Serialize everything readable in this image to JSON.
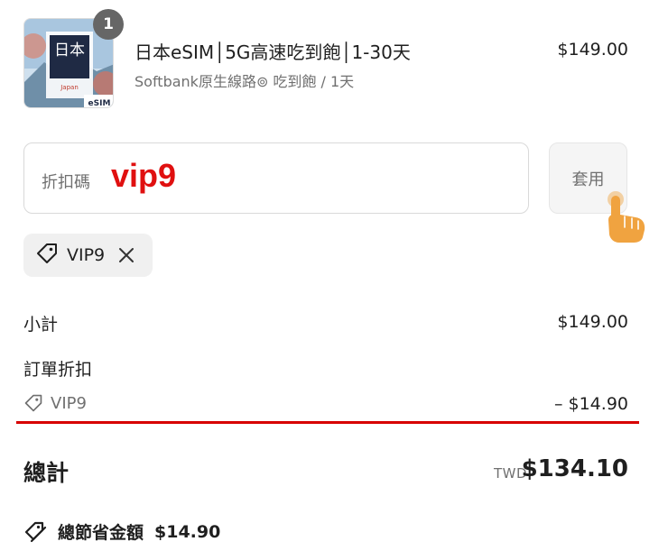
{
  "product": {
    "quantity": "1",
    "title": "日本eSIM│5G高速吃到飽│1-30天",
    "variant": "Softbank原生線路⊚ 吃到飽 / 1天",
    "price": "$149.00",
    "image_text": {
      "main": "日本",
      "place": "Japan",
      "brand": "eSIM"
    }
  },
  "discount": {
    "placeholder": "折扣碼",
    "value": "vip9",
    "apply_label": "套用",
    "applied_code": "VIP9"
  },
  "summary": {
    "subtotal_label": "小計",
    "subtotal_value": "$149.00",
    "order_discount_label": "訂單折扣",
    "discount_code": "VIP9",
    "discount_value": "– $14.90",
    "total_label": "總計",
    "currency": "TWD",
    "total_value": "$134.10",
    "savings_label": "總節省金額",
    "savings_value": "$14.90"
  },
  "colors": {
    "accent_red": "#d70000",
    "code_red": "#e01010",
    "hand": "#f0a340"
  }
}
